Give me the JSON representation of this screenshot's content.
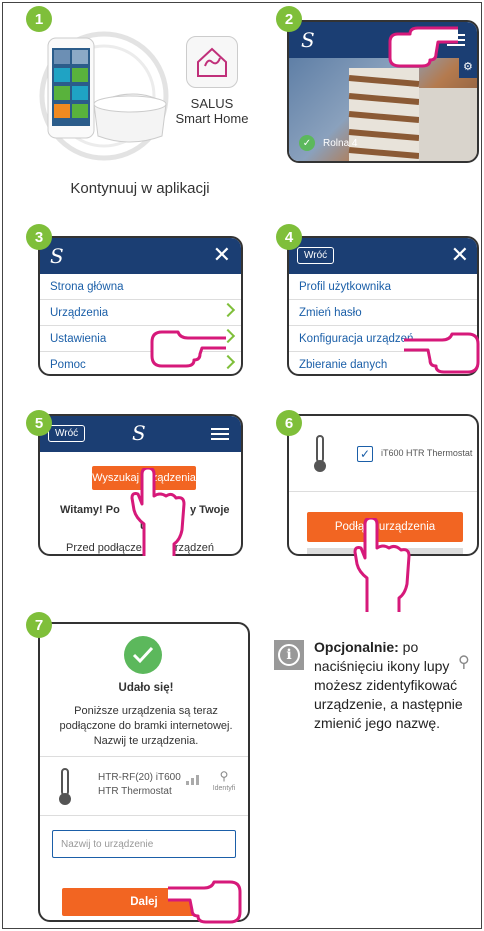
{
  "steps": [
    "1",
    "2",
    "3",
    "4",
    "5",
    "6",
    "7"
  ],
  "step1": {
    "app_name_line1": "SALUS",
    "app_name_line2": "Smart Home",
    "caption": "Kontynuuj w aplikacji"
  },
  "step2": {
    "location_name": "Rolna 4"
  },
  "step3": {
    "menu": [
      "Strona główna",
      "Urządzenia",
      "Ustawienia",
      "Pomoc"
    ]
  },
  "step4": {
    "back_label": "Wróć",
    "menu": [
      "Profil użytkownika",
      "Zmień hasło",
      "Konfiguracja urządzeń",
      "Zbieranie danych"
    ]
  },
  "step5": {
    "back_label": "Wróć",
    "search_button": "Wyszukaj urządzenia",
    "welcome_left": "Witamy! Po",
    "welcome_right": "y Twoje",
    "welcome_line2": "u",
    "intro_text": "Przed podłączeniem urządzeń"
  },
  "step6": {
    "device_name": "iT600 HTR Thermostat",
    "connect_button": "Podłącz urządzenia"
  },
  "step7": {
    "success_title": "Udało się!",
    "message": "Poniższe urządzenia są teraz podłączone do bramki internetowej. Nazwij te urządzenia.",
    "device_line1": "HTR-RF(20) iT600",
    "device_line2": "HTR Thermostat",
    "identify_label": "Identyfi",
    "name_placeholder": "Nazwij to urządzenie",
    "next_button": "Dalej"
  },
  "note": {
    "bold": "Opcjonalnie:",
    "text": " po naciśnięciu ikony lupy możesz zidentyfikować urządzenie, a następnie zmienić jego nazwę."
  },
  "colors": {
    "header": "#1b3e73",
    "accent_green": "#7fbf3a",
    "orange": "#f26522",
    "link_blue": "#1b5fa8",
    "hand_magenta": "#d6197a"
  }
}
